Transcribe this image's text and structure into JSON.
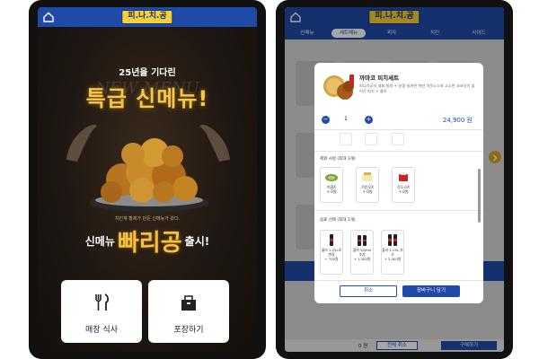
{
  "brand": {
    "logo_text": "피.나.치.공"
  },
  "promo": {
    "subheadline": "25년을 기다린",
    "watermark": "NEW MENU",
    "headline": "특급 신메뉴!",
    "tagline": "치킨계 황제가 만든 신메뉴가 왔다.",
    "launch_prefix": "신메뉴",
    "launch_name": "빠리공",
    "launch_suffix": "출시!"
  },
  "order_options": [
    {
      "label": "매장 식사",
      "icon": "fork-knife-icon"
    },
    {
      "label": "포장하기",
      "icon": "takeout-bag-icon"
    }
  ],
  "tabs": [
    {
      "label": "신메뉴",
      "active": false
    },
    {
      "label": "세트메뉴",
      "active": true
    },
    {
      "label": "피자",
      "active": false
    },
    {
      "label": "치킨",
      "active": false
    },
    {
      "label": "사이드",
      "active": false
    }
  ],
  "modal": {
    "title": "까마코 피치세트",
    "description": "피나치공의 대표 피자 + 달콤 달싸한 까만 아웃소스와 고소한 코코넛이 들어간 피치 + 콜라",
    "quantity": "1",
    "price": "24,900 원",
    "section_remove": "제외 사항 (최대 3개)",
    "remove_options": [
      {
        "name": "피클X",
        "price": "+ 0원"
      },
      {
        "name": "치킨무X",
        "price": "+ 0원"
      },
      {
        "name": "핫소스X",
        "price": "+ 0원"
      }
    ],
    "section_drink": "음료 선택 (최대 1개)",
    "drink_options": [
      {
        "name": "콜라 1.25L로 변경",
        "price": "+ 700원"
      },
      {
        "name": "콜라 500ml 추가",
        "price": "+ 1,300원"
      },
      {
        "name": "콜라 1.25L 추가",
        "price": "+ 2,000원"
      }
    ],
    "cancel_label": "취소",
    "add_label": "장바구니 담기"
  },
  "bottom_bar": {
    "total": "0 원",
    "clear_label": "전체 취소",
    "pay_label": "구매하기"
  },
  "colors": {
    "primary": "#1f4aa8",
    "accent_gold": "#f3c043",
    "logo_yellow": "#f4d13a"
  }
}
